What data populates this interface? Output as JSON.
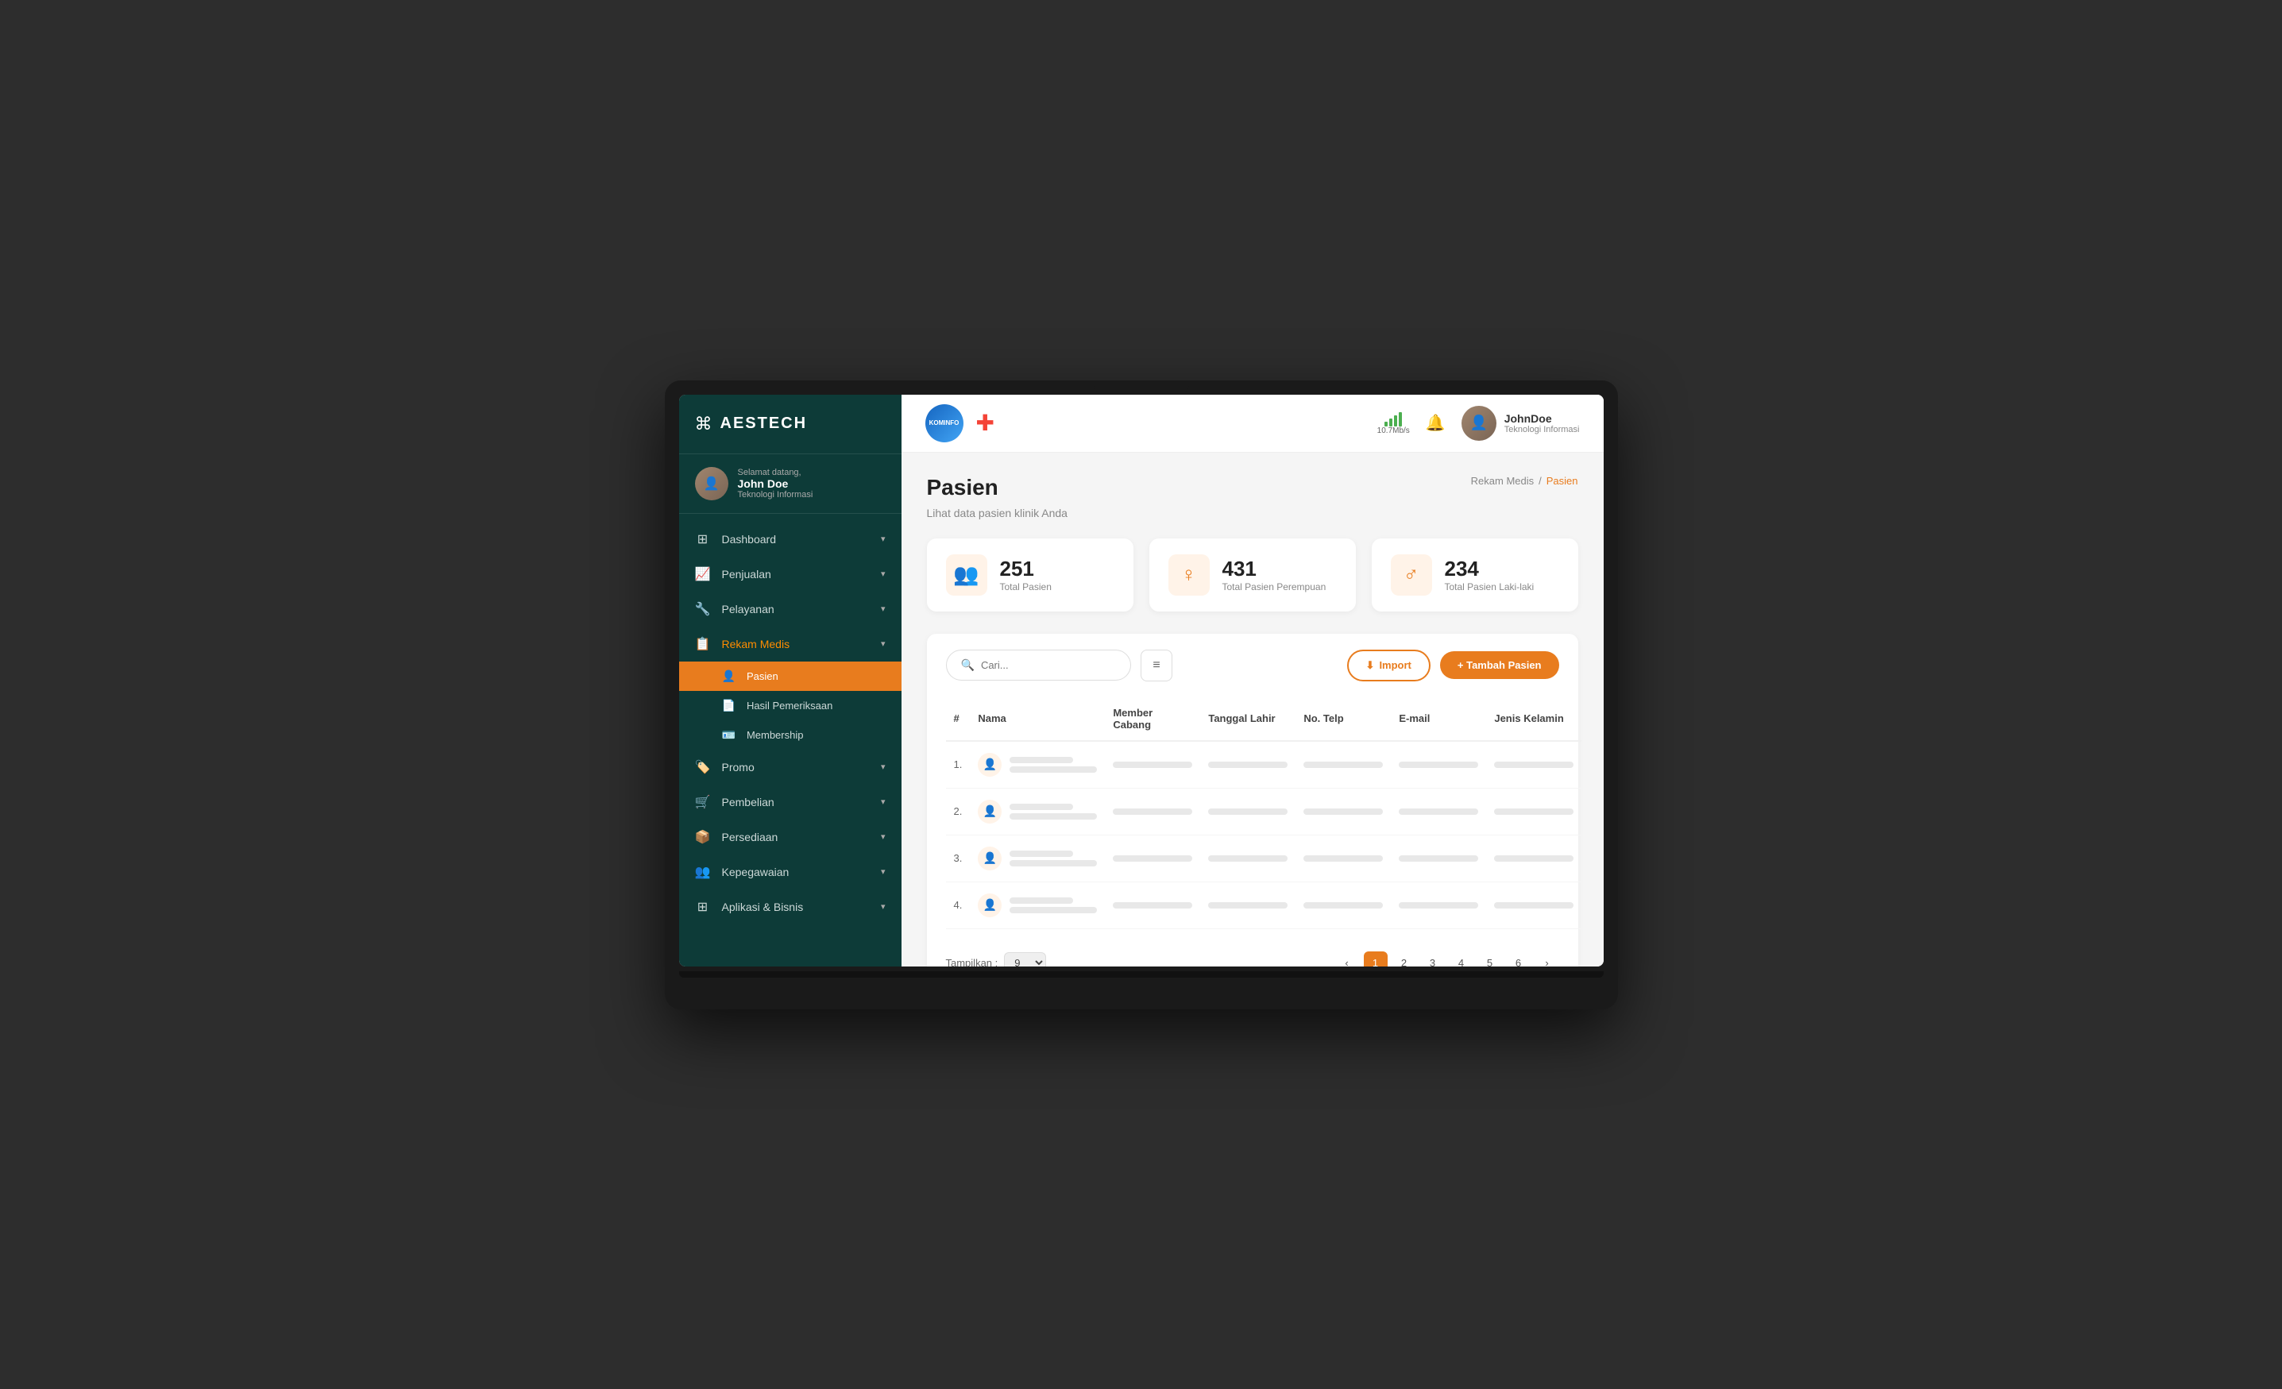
{
  "app": {
    "name": "AESTECH"
  },
  "sidebar": {
    "greeting": "Selamat datang,",
    "user": {
      "name": "John Doe",
      "role": "Teknologi Informasi"
    },
    "nav": [
      {
        "id": "dashboard",
        "label": "Dashboard",
        "icon": "⊞",
        "hasChildren": true
      },
      {
        "id": "penjualan",
        "label": "Penjualan",
        "icon": "📈",
        "hasChildren": true
      },
      {
        "id": "pelayanan",
        "label": "Pelayanan",
        "icon": "🔧",
        "hasChildren": true
      },
      {
        "id": "rekam-medis",
        "label": "Rekam Medis",
        "icon": "📋",
        "hasChildren": true,
        "active": true
      }
    ],
    "subnav": [
      {
        "id": "pasien",
        "label": "Pasien",
        "icon": "👤",
        "active": true
      },
      {
        "id": "hasil-pemeriksaan",
        "label": "Hasil Pemeriksaan",
        "icon": "📄"
      },
      {
        "id": "membership",
        "label": "Membership",
        "icon": "🪪"
      }
    ],
    "nav2": [
      {
        "id": "promo",
        "label": "Promo",
        "icon": "🏷️",
        "hasChildren": true
      },
      {
        "id": "pembelian",
        "label": "Pembelian",
        "icon": "🛒",
        "hasChildren": true
      },
      {
        "id": "persediaan",
        "label": "Persediaan",
        "icon": "📦",
        "hasChildren": true
      },
      {
        "id": "kepegawaian",
        "label": "Kepegawaian",
        "icon": "👥",
        "hasChildren": true
      },
      {
        "id": "aplikasi-bisnis",
        "label": "Aplikasi & Bisnis",
        "icon": "⊞",
        "hasChildren": true
      }
    ]
  },
  "topbar": {
    "kominfo_label": "KOMINFO",
    "speed_label": "10.7Mb/s",
    "user": {
      "name": "JohnDoe",
      "role": "Teknologi Informasi"
    }
  },
  "page": {
    "title": "Pasien",
    "subtitle": "Lihat data pasien klinik Anda",
    "breadcrumb_parent": "Rekam Medis",
    "breadcrumb_current": "Pasien"
  },
  "stats": [
    {
      "id": "total",
      "number": "251",
      "label": "Total Pasien",
      "icon": "👥"
    },
    {
      "id": "perempuan",
      "number": "431",
      "label": "Total Pasien Perempuan",
      "icon": "♀"
    },
    {
      "id": "laki-laki",
      "number": "234",
      "label": "Total Pasien Laki-laki",
      "icon": "♂"
    }
  ],
  "toolbar": {
    "search_placeholder": "Cari...",
    "import_label": "Import",
    "tambah_label": "+ Tambah Pasien"
  },
  "table": {
    "columns": [
      "#",
      "Nama",
      "Member Cabang",
      "Tanggal Lahir",
      "No. Telp",
      "E-mail",
      "Jenis Kelamin"
    ],
    "rows": [
      {
        "num": "1."
      },
      {
        "num": "2."
      },
      {
        "num": "3."
      },
      {
        "num": "4."
      }
    ]
  },
  "pagination": {
    "show_label": "Tampilkan :",
    "show_value": "9",
    "pages": [
      "1",
      "2",
      "3",
      "4",
      "5",
      "6"
    ],
    "active_page": "1"
  }
}
